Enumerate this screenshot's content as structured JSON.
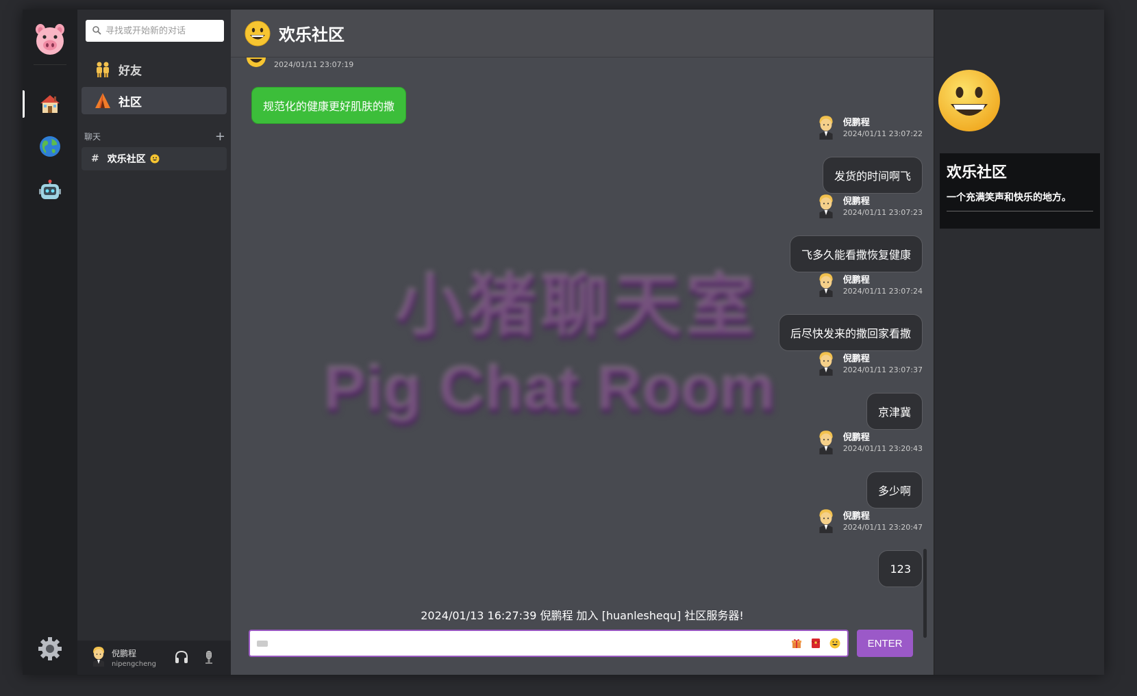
{
  "search": {
    "placeholder": "寻找或开始新的对话"
  },
  "sidebar": {
    "nav": [
      {
        "label": "好友"
      },
      {
        "label": "社区"
      }
    ],
    "section_title": "聊天",
    "channel": {
      "hash": "#",
      "name": "欢乐社区"
    },
    "user": {
      "name": "倪鹏程",
      "id": "nipengcheng"
    }
  },
  "header": {
    "title": "欢乐社区"
  },
  "watermark": {
    "line1": "小猪聊天室",
    "line2": "Pig Chat Room"
  },
  "messages": {
    "first_time": "2024/01/11 23:07:19",
    "first_text": "规范化的健康更好肌肤的撒",
    "items": [
      {
        "name": "倪鹏程",
        "time": "2024/01/11 23:07:22",
        "text": "发货的时间啊飞"
      },
      {
        "name": "倪鹏程",
        "time": "2024/01/11 23:07:23",
        "text": "飞多久能看撒恢复健康"
      },
      {
        "name": "倪鹏程",
        "time": "2024/01/11 23:07:24",
        "text": "后尽快发来的撒回家看撒"
      },
      {
        "name": "倪鹏程",
        "time": "2024/01/11 23:07:37",
        "text": "京津冀"
      },
      {
        "name": "倪鹏程",
        "time": "2024/01/11 23:20:43",
        "text": "多少啊"
      },
      {
        "name": "倪鹏程",
        "time": "2024/01/11 23:20:47",
        "text": "123"
      }
    ],
    "system": "2024/01/13 16:27:39  倪鹏程 加入 [huanleshequ] 社区服务器!"
  },
  "composer": {
    "enter_label": "ENTER"
  },
  "info": {
    "title": "欢乐社区",
    "desc": "一个充满笑声和快乐的地方。"
  },
  "colors": {
    "accent": "#9b59c8",
    "green_bubble": "#3cbe3a",
    "main_bg": "#484a50",
    "rail_bg": "#1e1f22",
    "sidebar_bg": "#2c2d31"
  },
  "icons": [
    "pig-logo-icon",
    "home-icon",
    "globe-icon",
    "robot-icon",
    "gear-icon",
    "search-icon",
    "friends-icon",
    "community-tent-icon",
    "plus-icon",
    "smile-emoji-icon",
    "user-avatar-icon",
    "headphones-icon",
    "microphone-icon",
    "gift-icon",
    "red-envelope-icon",
    "keyboard-icon"
  ]
}
